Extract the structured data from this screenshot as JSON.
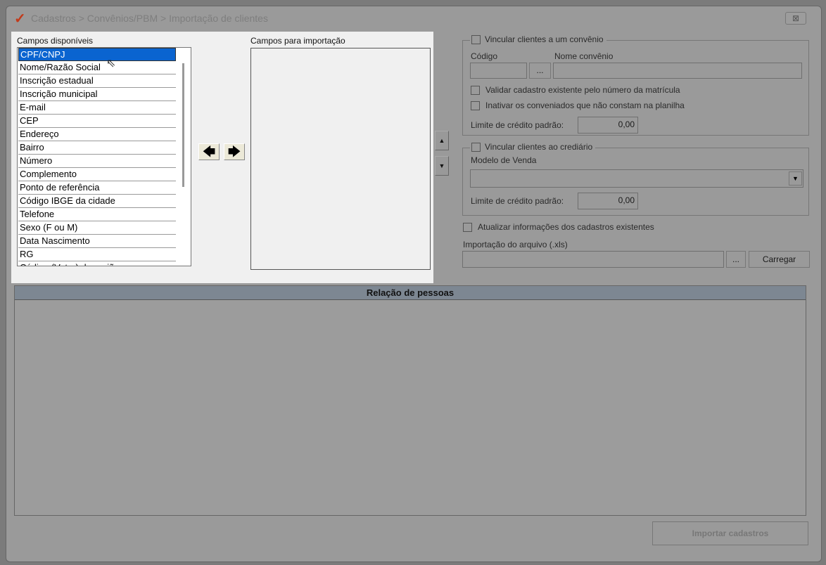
{
  "window": {
    "title": "Cadastros > Convênios/PBM > Importação de clientes",
    "close": "⊠"
  },
  "available": {
    "label": "Campos disponíveis",
    "items": [
      "CPF/CNPJ",
      "Nome/Razão Social",
      "Inscrição estadual",
      "Inscrição municipal",
      "E-mail",
      "CEP",
      "Endereço",
      "Bairro",
      "Número",
      "Complemento",
      "Ponto de referência",
      "Código IBGE da cidade",
      "Telefone",
      "Sexo (F ou M)",
      "Data Nascimento",
      "RG",
      "Código (Vetor) da região"
    ],
    "selected_index": 0
  },
  "import_fields": {
    "label": "Campos para importação"
  },
  "move": {
    "left": "🡄",
    "right": "🡆",
    "up": "▲",
    "down": "▼"
  },
  "convenio": {
    "title": "Vincular clientes a um convênio",
    "codigo_label": "Código",
    "nome_label": "Nome convênio",
    "browse": "...",
    "validar": "Validar cadastro existente pelo número da matrícula",
    "inativar": "Inativar os conveniados que não constam na planilha",
    "limite_label": "Limite de crédito padrão:",
    "limite_value": "0,00"
  },
  "crediario": {
    "title": "Vincular clientes ao crediário",
    "modelo_label": "Modelo de Venda",
    "limite_label": "Limite de crédito padrão:",
    "limite_value": "0,00"
  },
  "atualizar": "Atualizar informações dos cadastros existentes",
  "arquivo": {
    "label": "Importação do arquivo (.xls)",
    "browse": "...",
    "load": "Carregar"
  },
  "grid": {
    "title": "Relação de pessoas"
  },
  "import_button": "Importar cadastros"
}
